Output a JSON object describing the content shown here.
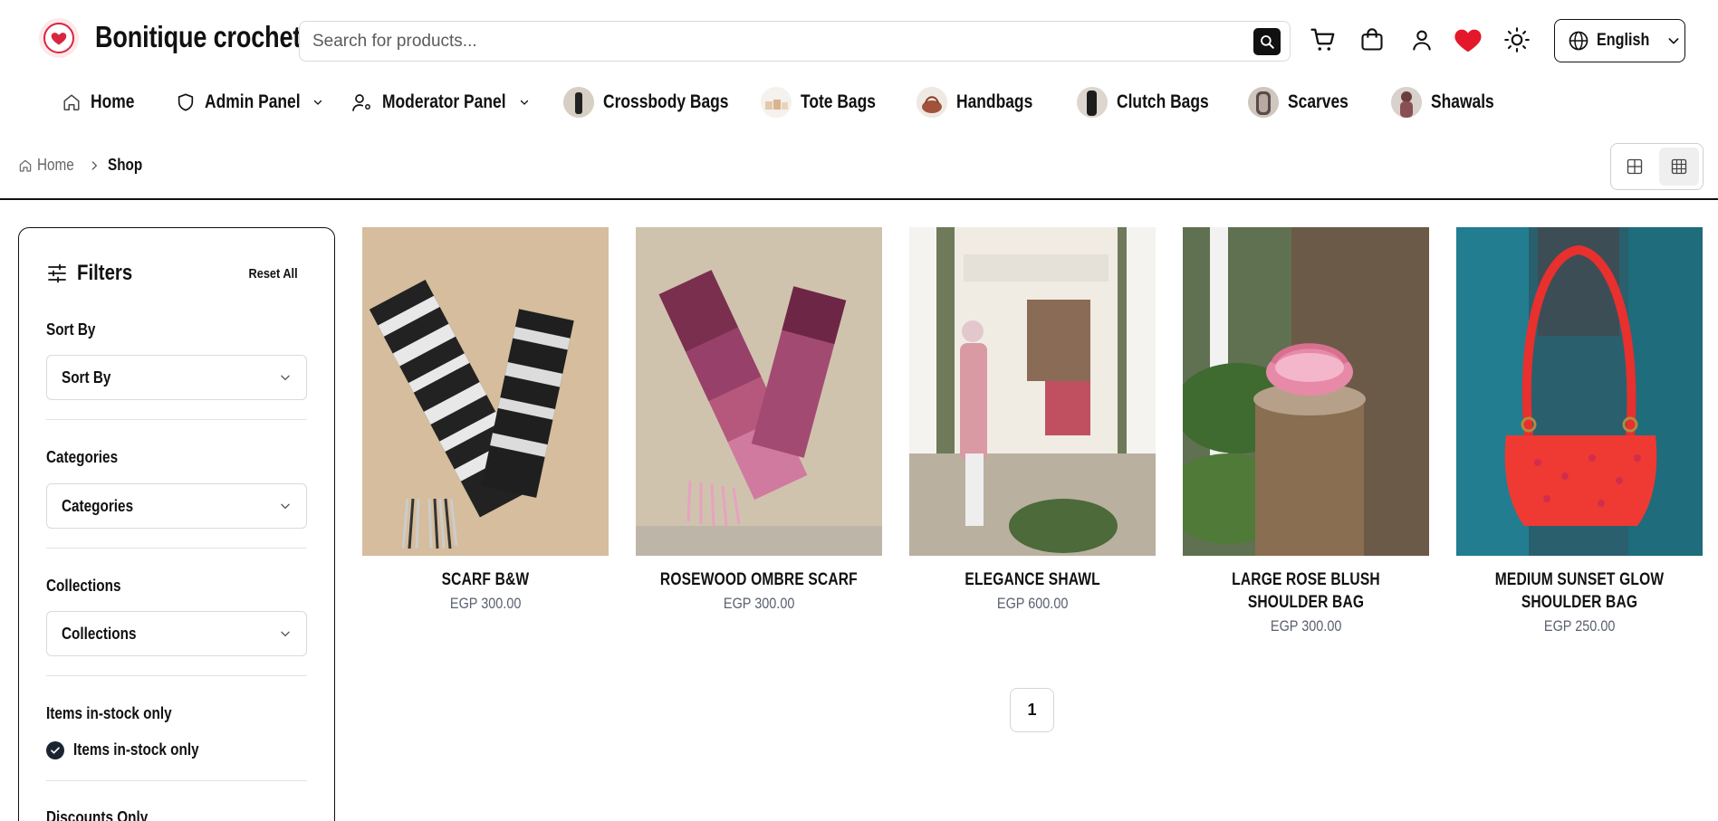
{
  "header": {
    "brand": "Bonitique crochet",
    "search_placeholder": "Search for products...",
    "language": "English",
    "icons": [
      "search-icon",
      "cart-icon",
      "shopping-bag-icon",
      "user-icon",
      "heart-icon",
      "sun-icon",
      "globe-icon"
    ],
    "accent_color": "#e3192b"
  },
  "nav": {
    "items": [
      {
        "label": "Home",
        "icon": "home-icon"
      },
      {
        "label": "Admin Panel",
        "icon": "shield-icon",
        "dropdown": true
      },
      {
        "label": "Moderator Panel",
        "icon": "user-cog-icon",
        "dropdown": true
      },
      {
        "label": "Crossbody Bags",
        "icon": "category-thumbnail"
      },
      {
        "label": "Tote Bags",
        "icon": "category-thumbnail"
      },
      {
        "label": "Handbags",
        "icon": "category-thumbnail"
      },
      {
        "label": "Clutch Bags",
        "icon": "category-thumbnail"
      },
      {
        "label": "Scarves",
        "icon": "category-thumbnail"
      },
      {
        "label": "Shawals",
        "icon": "category-thumbnail"
      }
    ]
  },
  "breadcrumb": {
    "home": "Home",
    "current": "Shop"
  },
  "filters": {
    "title": "Filters",
    "reset": "Reset All",
    "sort_label": "Sort By",
    "sort_value": "Sort By",
    "categories_label": "Categories",
    "categories_value": "Categories",
    "collections_label": "Collections",
    "collections_value": "Collections",
    "stock_label": "Items in-stock only",
    "stock_option": "Items in-stock only",
    "stock_checked": true,
    "discounts_label": "Discounts Only"
  },
  "products": [
    {
      "name": "SCARF B&W",
      "price": "EGP 300.00"
    },
    {
      "name": "ROSEWOOD OMBRE SCARF",
      "price": "EGP 300.00"
    },
    {
      "name": "ELEGANCE SHAWL",
      "price": "EGP 600.00"
    },
    {
      "name": "LARGE ROSE BLUSH SHOULDER BAG",
      "price": "EGP 300.00"
    },
    {
      "name": "MEDIUM SUNSET GLOW SHOULDER BAG",
      "price": "EGP 250.00"
    }
  ],
  "pagination": {
    "current_page": "1"
  }
}
